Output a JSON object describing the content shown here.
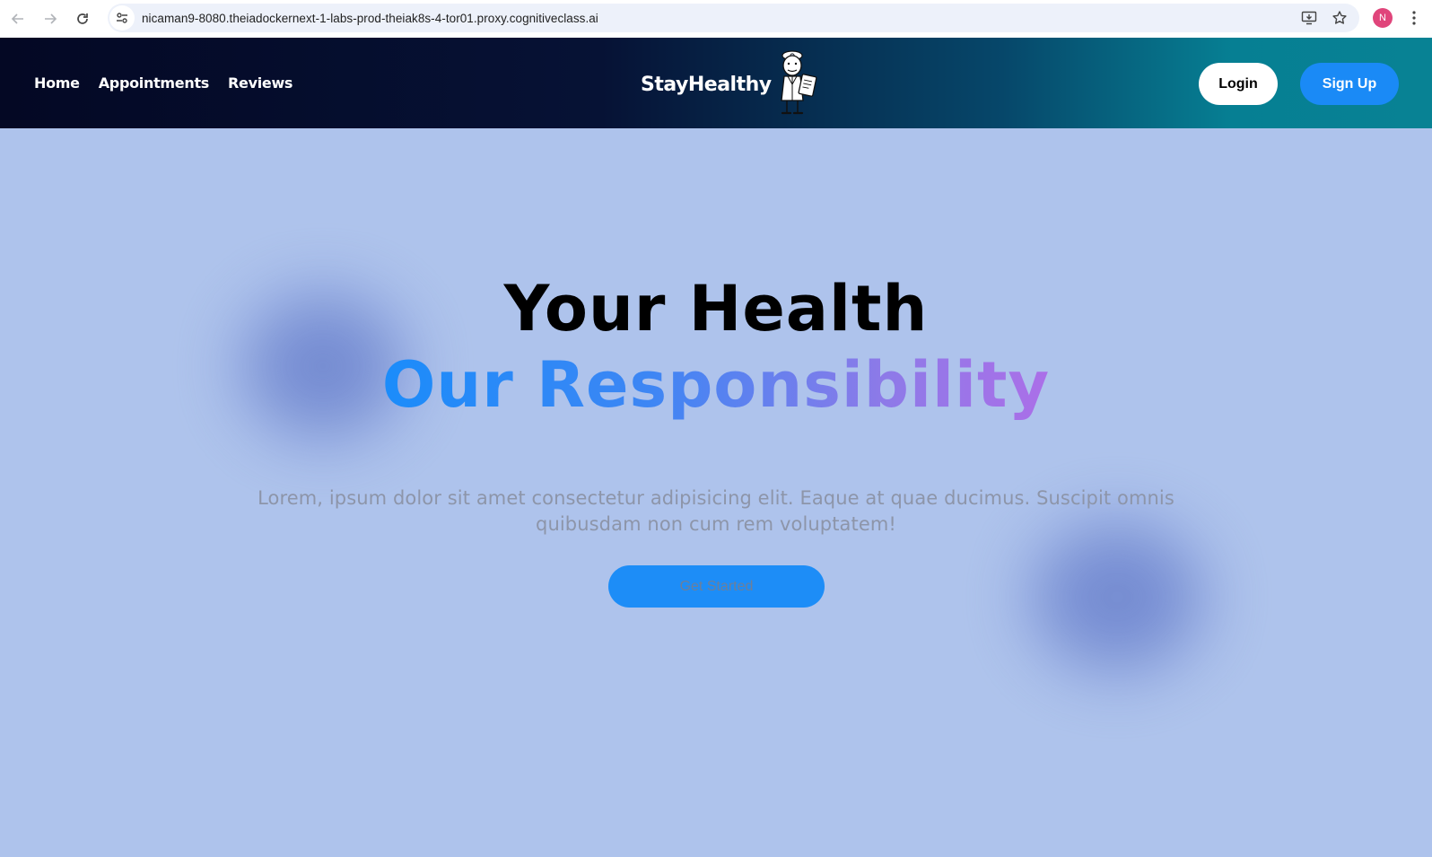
{
  "browser": {
    "url": "nicaman9-8080.theiadockernext-1-labs-prod-theiak8s-4-tor01.proxy.cognitiveclass.ai",
    "profile_initial": "N",
    "icons": [
      "back-arrow-icon",
      "forward-arrow-icon",
      "reload-icon",
      "site-info-icon",
      "install-app-icon",
      "bookmark-star-icon",
      "more-menu-icon"
    ]
  },
  "navbar": {
    "links": [
      "Home",
      "Appointments",
      "Reviews"
    ],
    "brand": "StayHealthy",
    "login_label": "Login",
    "signup_label": "Sign Up"
  },
  "hero": {
    "title": "Your Health",
    "subtitle": "Our Responsibility",
    "paragraph": "Lorem, ipsum dolor sit amet consectetur adipisicing elit. Eaque at quae ducimus. Suscipit omnis quibusdam non cum rem voluptatem!",
    "cta_label": "Get Started"
  },
  "colors": {
    "hero_background": "#aec3ec",
    "primary_button": "#1a8af6",
    "gradient_start": "#1b8cfa",
    "gradient_end": "#ab6fe8"
  }
}
